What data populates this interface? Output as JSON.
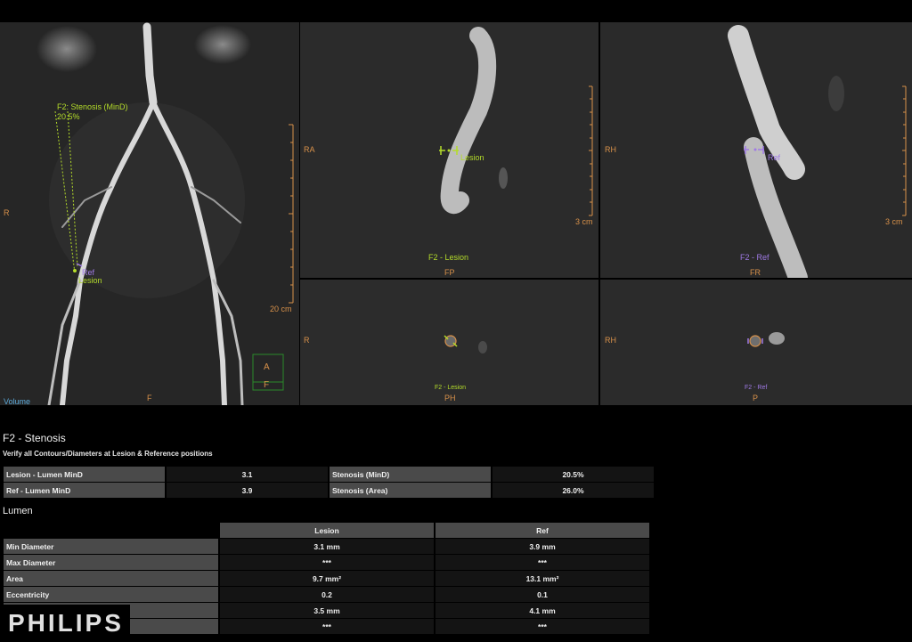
{
  "viewports": {
    "volume": {
      "annotation_line1": "F2: Stenosis (MinD)",
      "annotation_line2": "20.5%",
      "ref_label": "Ref",
      "lesion_label": "Lesion",
      "left_orient": "R",
      "bottom_orient": "F",
      "scale_label": "20 cm",
      "link_label": "Volume",
      "cube_top": "A",
      "cube_bottom": "F"
    },
    "lesion_long": {
      "left_orient": "RA",
      "bottom_orient": "FP",
      "marker_label": "Lesion",
      "title": "F2 - Lesion",
      "scale_label": "3 cm"
    },
    "ref_long": {
      "left_orient": "RH",
      "bottom_orient": "FR",
      "marker_label": "Ref",
      "title": "F2 - Ref",
      "scale_label": "3 cm"
    },
    "lesion_cross": {
      "left_orient": "R",
      "bottom_orient": "PH",
      "title": "F2 - Lesion"
    },
    "ref_cross": {
      "left_orient": "RH",
      "bottom_orient": "P",
      "title": "F2 - Ref"
    }
  },
  "report": {
    "title": "F2 - Stenosis",
    "subtitle": "Verify all Contours/Diameters at Lesion & Reference positions",
    "summary": [
      {
        "label": "Lesion - Lumen MinD",
        "value": "3.1",
        "label2": "Stenosis (MinD)",
        "value2": "20.5%"
      },
      {
        "label": "Ref - Lumen MinD",
        "value": "3.9",
        "label2": "Stenosis (Area)",
        "value2": "26.0%"
      }
    ],
    "lumen_title": "Lumen",
    "lumen_headers": [
      "Lesion",
      "Ref"
    ],
    "lumen_rows": [
      {
        "label": "Min Diameter",
        "lesion": "3.1 mm",
        "ref": "3.9 mm"
      },
      {
        "label": "Max Diameter",
        "lesion": "***",
        "ref": "***"
      },
      {
        "label": "Area",
        "lesion": "9.7 mm²",
        "ref": "13.1 mm²"
      },
      {
        "label": "Eccentricity",
        "lesion": "0.2",
        "ref": "0.1"
      },
      {
        "label": "",
        "lesion": "3.5 mm",
        "ref": "4.1 mm"
      },
      {
        "label": "",
        "lesion": "***",
        "ref": "***"
      }
    ]
  },
  "brand": {
    "logo": "PHILIPS"
  }
}
